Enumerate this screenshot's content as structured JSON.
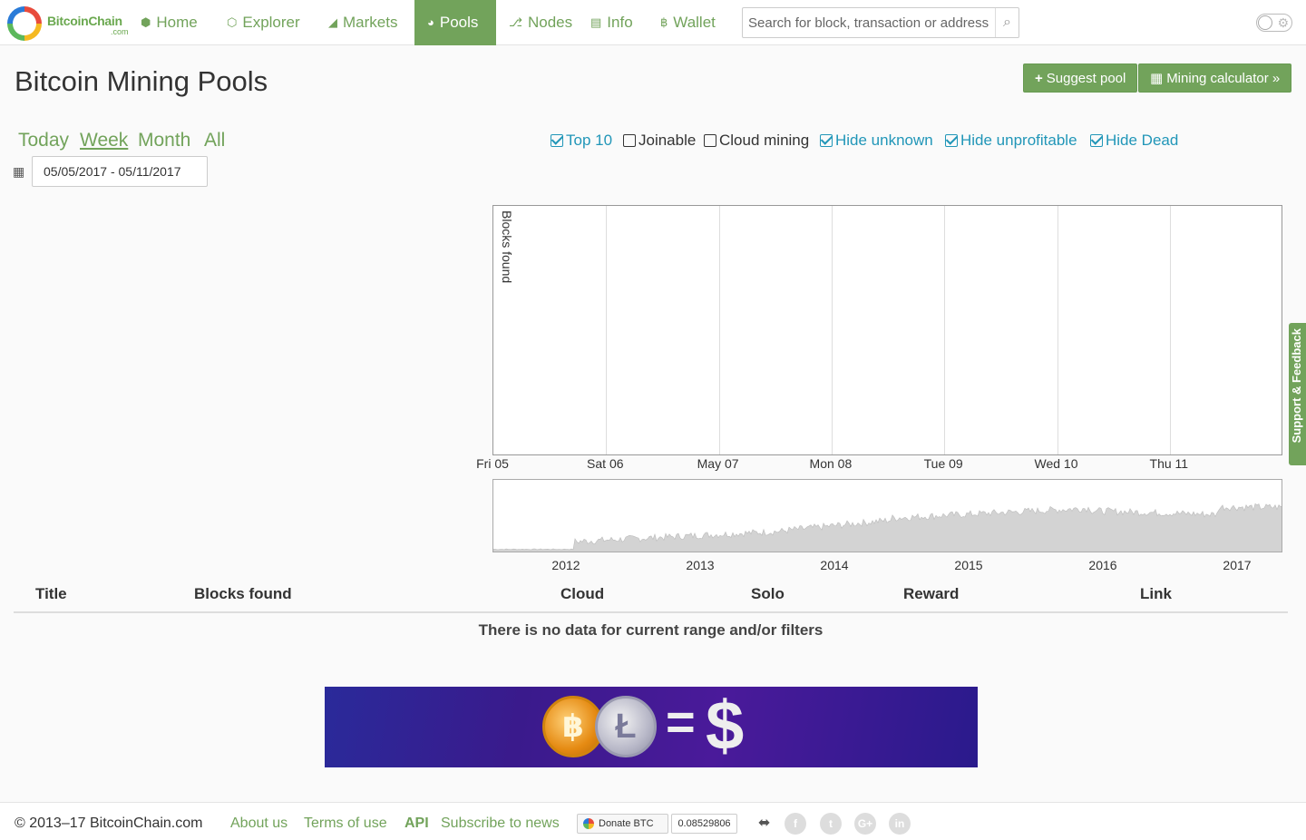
{
  "nav": {
    "logo_name": "BitcoinChain",
    "logo_sub": ".com",
    "items": [
      {
        "label": "Home",
        "icon": "cube-icon"
      },
      {
        "label": "Explorer",
        "icon": "explorer-icon"
      },
      {
        "label": "Markets",
        "icon": "area-chart-icon"
      },
      {
        "label": "Pools",
        "icon": "pie-chart-icon"
      },
      {
        "label": "Nodes",
        "icon": "nodes-icon"
      },
      {
        "label": "Info",
        "icon": "book-icon"
      },
      {
        "label": "Wallet",
        "icon": "bitcoin-icon"
      }
    ],
    "search_placeholder": "Search for block, transaction or address"
  },
  "header": {
    "title": "Bitcoin Mining Pools",
    "suggest_label": "Suggest pool",
    "calculator_label": "Mining calculator »"
  },
  "range": {
    "tabs": [
      "Today",
      "Week",
      "Month",
      "All"
    ],
    "active": "Week",
    "date_value": "05/05/2017 - 05/11/2017"
  },
  "filters": [
    {
      "label": "Top 10",
      "checked": true
    },
    {
      "label": "Joinable",
      "checked": false
    },
    {
      "label": "Cloud mining",
      "checked": false
    },
    {
      "label": "Hide unknown",
      "checked": true
    },
    {
      "label": "Hide unprofitable",
      "checked": true
    },
    {
      "label": "Hide Dead",
      "checked": true
    }
  ],
  "chart_data": [
    {
      "type": "line",
      "ylabel": "Blocks found",
      "x": [
        "Fri 05",
        "Sat 06",
        "May 07",
        "Mon 08",
        "Tue 09",
        "Wed 10",
        "Thu 11"
      ],
      "series": []
    },
    {
      "type": "area",
      "x": [
        "2012",
        "2013",
        "2014",
        "2015",
        "2016",
        "2017"
      ]
    }
  ],
  "table": {
    "headers": [
      "Title",
      "Blocks found",
      "Cloud",
      "Solo",
      "Reward",
      "Link"
    ],
    "empty_message": "There is no data for current range and/or filters"
  },
  "feedback_label": "Support & Feedback",
  "footer": {
    "copyright": "© 2013–17 BitcoinChain.com",
    "links": [
      "About us",
      "Terms of use",
      "API",
      "Subscribe to news"
    ],
    "donate_label": "Donate BTC",
    "donate_amount": "0.08529806"
  },
  "colors": {
    "accent": "#72a35b",
    "filter_on": "#2196b8"
  }
}
